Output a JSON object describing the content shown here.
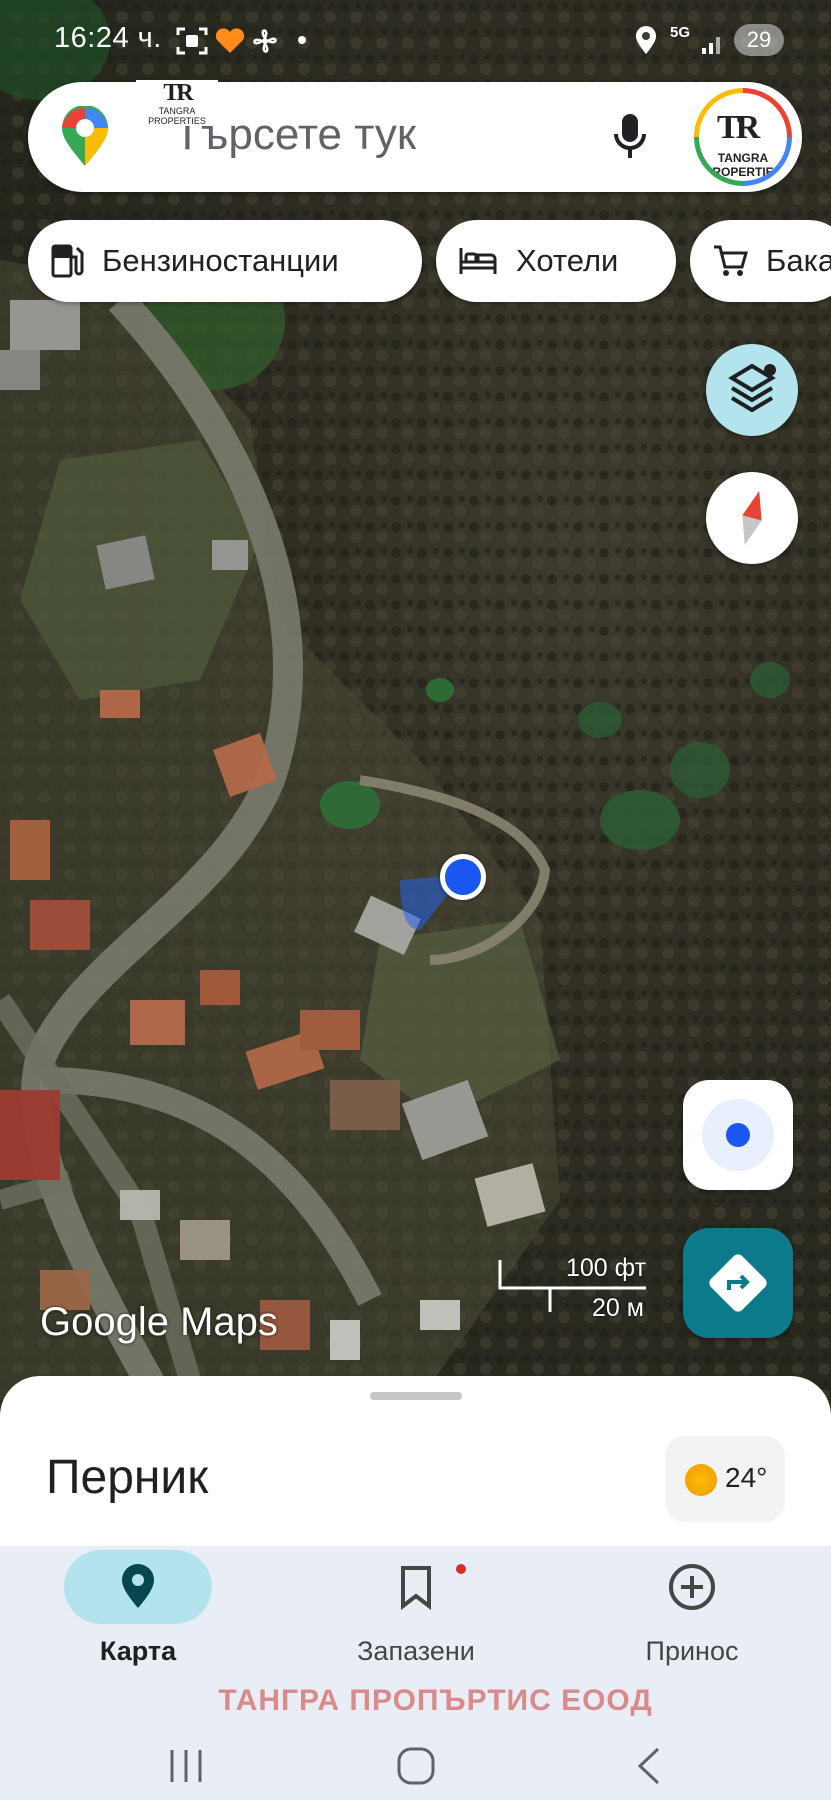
{
  "status_bar": {
    "time": "16:24 ч.",
    "network": "5G",
    "battery": "29"
  },
  "search": {
    "placeholder": "Търсете тук"
  },
  "watermark": {
    "logo_monogram": "TR",
    "logo_name": "TANGRA PROPERTIES",
    "avatar_name": "TANGRA PROPERTIES",
    "bottom_text": "ТАНГРА ПРОПЪРТИС  ЕООД"
  },
  "chips": [
    {
      "label": "Бензиностанции",
      "icon": "gas-station-icon"
    },
    {
      "label": "Хотели",
      "icon": "bed-icon"
    },
    {
      "label": "Бака",
      "icon": "cart-icon"
    }
  ],
  "map": {
    "scale_ft": "100 фт",
    "scale_m": "20 м",
    "attribution": "Google Maps",
    "location_dot_color": "#1a56f0"
  },
  "sheet": {
    "place_name": "Перник",
    "temperature": "24°"
  },
  "nav": {
    "items": [
      {
        "label": "Карта",
        "icon": "map-pin-icon",
        "active": true
      },
      {
        "label": "Запазени",
        "icon": "bookmark-icon",
        "active": false
      },
      {
        "label": "Принос",
        "icon": "add-circle-icon",
        "active": false
      }
    ]
  },
  "colors": {
    "accent_teal": "#00796b",
    "direction_button": "#0b7a8a",
    "layers_button": "#b3e3ed",
    "nav_bg": "#e9eef6"
  }
}
